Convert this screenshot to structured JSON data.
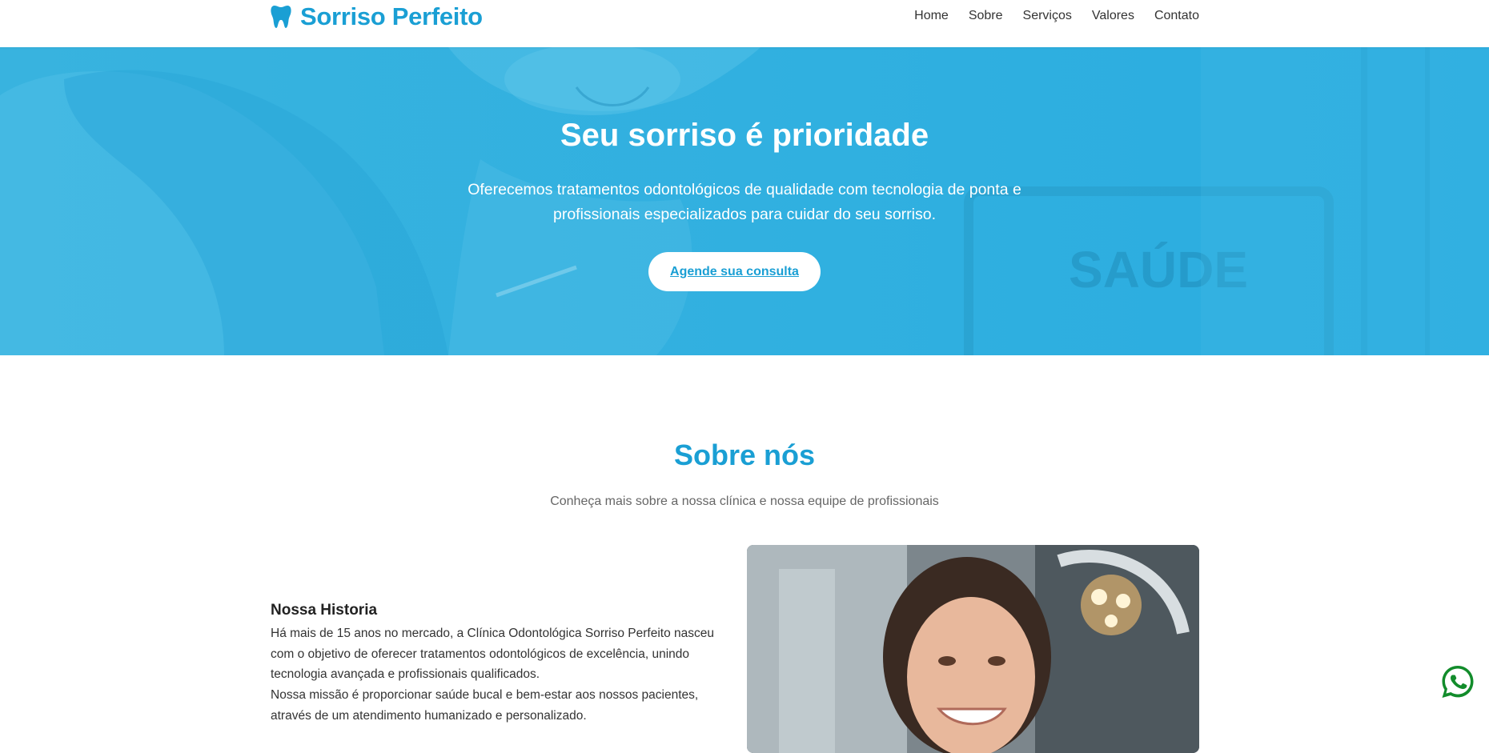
{
  "brand": {
    "name": "Sorriso Perfeito",
    "icon": "tooth-icon",
    "color": "#1a9fd4"
  },
  "nav": {
    "items": [
      "Home",
      "Sobre",
      "Serviços",
      "Valores",
      "Contato"
    ]
  },
  "hero": {
    "title": "Seu sorriso é prioridade",
    "subtitle_line1": "Oferecemos tratamentos odontológicos de qualidade com tecnologia de ponta e",
    "subtitle_line2": "profissionais especializados para cuidar do seu sorriso.",
    "cta": "Agende sua consulta",
    "overlay_color": "#2fb1df",
    "background_sign": "SAÚDE"
  },
  "about": {
    "title": "Sobre nós",
    "subtitle": "Conheça mais sobre a nossa clínica e nossa equipe de profissionais",
    "history_title": "Nossa Historia",
    "paragraph1": "Há mais de 15 anos no mercado, a Clínica Odontológica Sorriso Perfeito nasceu com o objetivo de oferecer tratamentos odontológicos de excelência, unindo tecnologia avançada e profissionais qualificados.",
    "paragraph2": "Nossa missão é proporcionar saúde bucal e bem-estar aos nossos pacientes, através de um atendimento humanizado e personalizado."
  },
  "whatsapp": {
    "icon": "whatsapp-icon",
    "color": "#128c2b"
  }
}
